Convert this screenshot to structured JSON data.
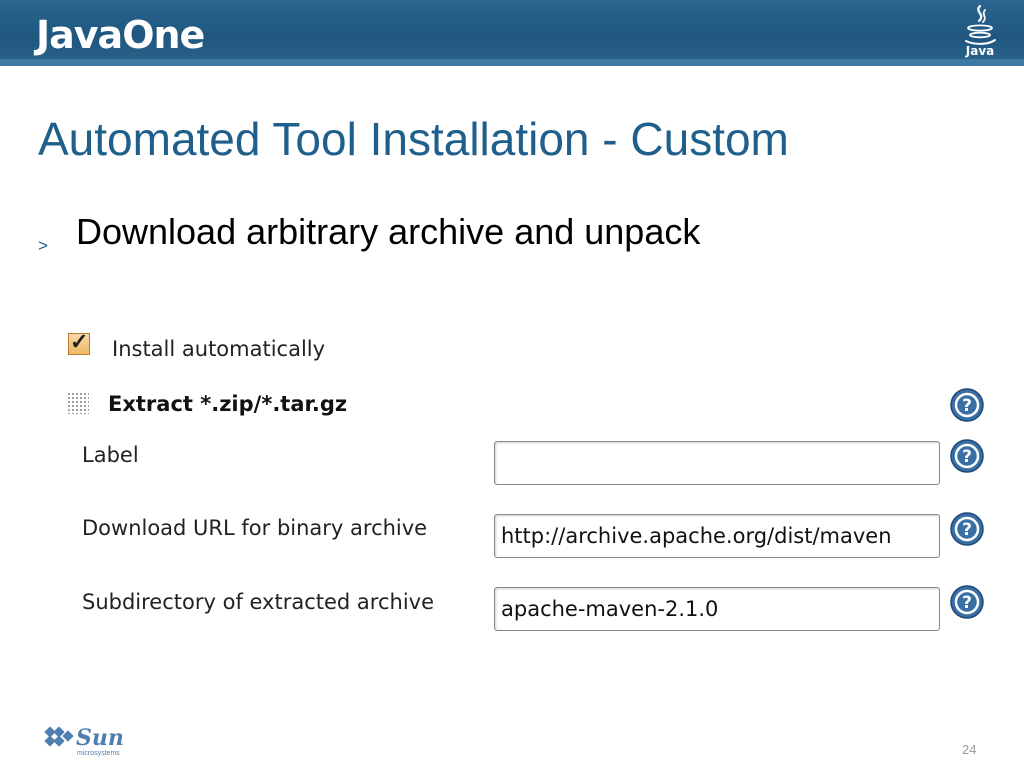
{
  "header": {
    "brand": "JavaOne",
    "java_logo_text": "Java"
  },
  "slide": {
    "title": "Automated Tool Installation - Custom",
    "bullet_marker": ">",
    "bullet": "Download arbitrary archive and unpack",
    "page_number": "24"
  },
  "form": {
    "install_automatically": {
      "checked": true,
      "label": "Install automatically"
    },
    "installer_title": "Extract *.zip/*.tar.gz",
    "fields": [
      {
        "label": "Label",
        "value": ""
      },
      {
        "label": "Download URL for binary archive",
        "value": "http://archive.apache.org/dist/maven"
      },
      {
        "label": "Subdirectory of extracted archive",
        "value": "apache-maven-2.1.0"
      }
    ]
  },
  "footer": {
    "logo_text": "Sun",
    "logo_subtext": "microsystems"
  },
  "colors": {
    "header": "#1f5780",
    "title": "#1f5f8b",
    "help_icon": "#3a6fa6"
  },
  "icons": [
    "java-logo-icon",
    "checkbox-checked-icon",
    "drag-handle-icon",
    "help-icon",
    "sun-logo-icon"
  ]
}
